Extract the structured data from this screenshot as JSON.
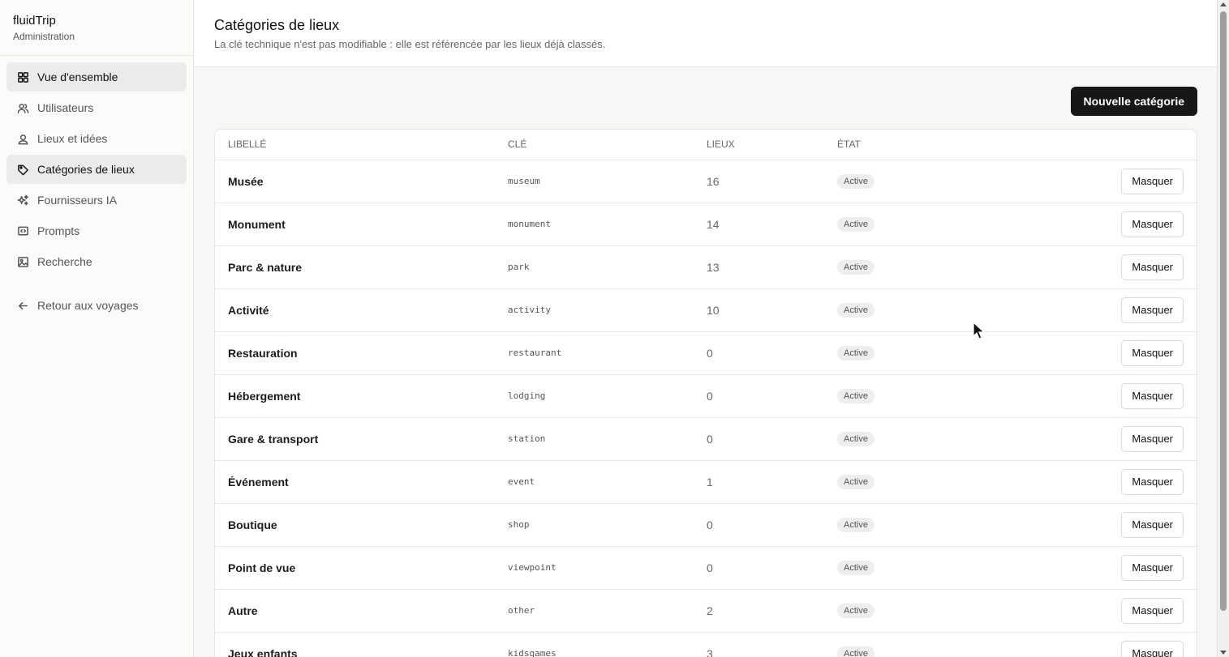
{
  "brand": {
    "name": "fluidTrip",
    "subtitle": "Administration"
  },
  "sidebar": {
    "items": [
      {
        "label": "Vue d'ensemble",
        "icon": "grid-icon",
        "active": true
      },
      {
        "label": "Utilisateurs",
        "icon": "users-icon",
        "active": false
      },
      {
        "label": "Lieux et idées",
        "icon": "map-pin-icon",
        "active": false
      },
      {
        "label": "Catégories de lieux",
        "icon": "tag-icon",
        "active": true
      },
      {
        "label": "Fournisseurs IA",
        "icon": "sparkles-icon",
        "active": false
      },
      {
        "label": "Prompts",
        "icon": "message-code-icon",
        "active": false
      },
      {
        "label": "Recherche",
        "icon": "image-search-icon",
        "active": false
      }
    ],
    "back_label": "Retour aux voyages",
    "back_icon": "arrow-left-icon"
  },
  "header": {
    "title": "Catégories de lieux",
    "description": "La clé technique n'est pas modifiable : elle est référencée par les lieux déjà classés."
  },
  "toolbar": {
    "new_label": "Nouvelle catégorie"
  },
  "table": {
    "columns": {
      "label": "Libellé",
      "key": "Clé",
      "count": "Lieux",
      "state": "État"
    },
    "action_label": "Masquer",
    "rows": [
      {
        "label": "Musée",
        "key": "museum",
        "count": "16",
        "state": "Active"
      },
      {
        "label": "Monument",
        "key": "monument",
        "count": "14",
        "state": "Active"
      },
      {
        "label": "Parc & nature",
        "key": "park",
        "count": "13",
        "state": "Active"
      },
      {
        "label": "Activité",
        "key": "activity",
        "count": "10",
        "state": "Active"
      },
      {
        "label": "Restauration",
        "key": "restaurant",
        "count": "0",
        "state": "Active"
      },
      {
        "label": "Hébergement",
        "key": "lodging",
        "count": "0",
        "state": "Active"
      },
      {
        "label": "Gare & transport",
        "key": "station",
        "count": "0",
        "state": "Active"
      },
      {
        "label": "Événement",
        "key": "event",
        "count": "1",
        "state": "Active"
      },
      {
        "label": "Boutique",
        "key": "shop",
        "count": "0",
        "state": "Active"
      },
      {
        "label": "Point de vue",
        "key": "viewpoint",
        "count": "0",
        "state": "Active"
      },
      {
        "label": "Autre",
        "key": "other",
        "count": "2",
        "state": "Active"
      },
      {
        "label": "Jeux enfants",
        "key": "kidsgames",
        "count": "3",
        "state": "Active"
      }
    ]
  },
  "colors": {
    "primary": "#171717",
    "active_nav_bg": "#ebebe9",
    "border": "#e6e6e3",
    "page_bg": "#f7f7f6"
  }
}
